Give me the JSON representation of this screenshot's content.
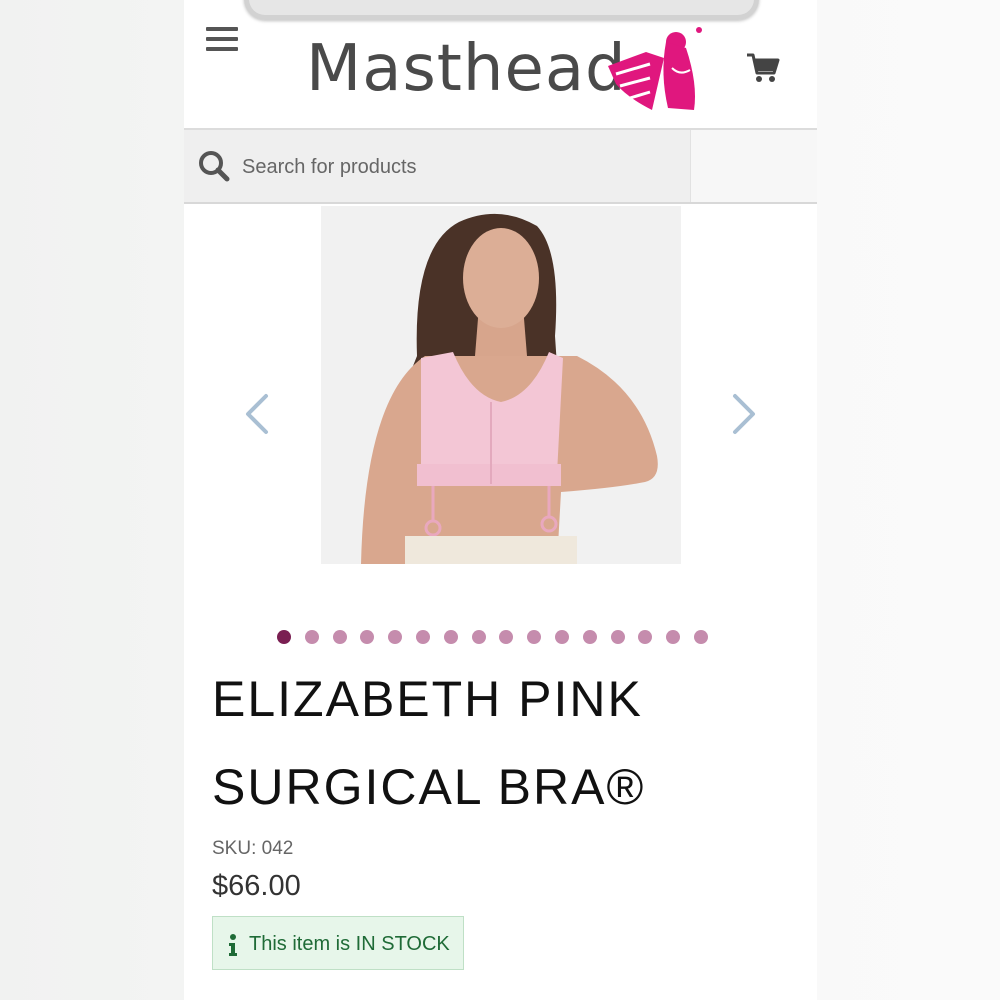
{
  "header": {
    "brand_name": "Masthead",
    "brand_color": "#e0177e",
    "menu_icon": "hamburger-menu-icon",
    "cart_icon": "shopping-cart-icon"
  },
  "search": {
    "placeholder": "Search for products",
    "value": ""
  },
  "carousel": {
    "image_alt": "Model wearing pink surgical bra",
    "prev_icon": "chevron-left-icon",
    "next_icon": "chevron-right-icon",
    "total_slides": 16,
    "active_slide": 1,
    "active_dot_color": "#7a1f52",
    "dot_color": "#c58cad"
  },
  "product": {
    "title_line1": "ELIZABETH PINK",
    "title_line2": "SURGICAL BRA®",
    "sku_label": "SKU:",
    "sku_value": "042",
    "price": "$66.00",
    "stock_text": "This item is IN STOCK",
    "stock_color": "#1f6b37"
  }
}
